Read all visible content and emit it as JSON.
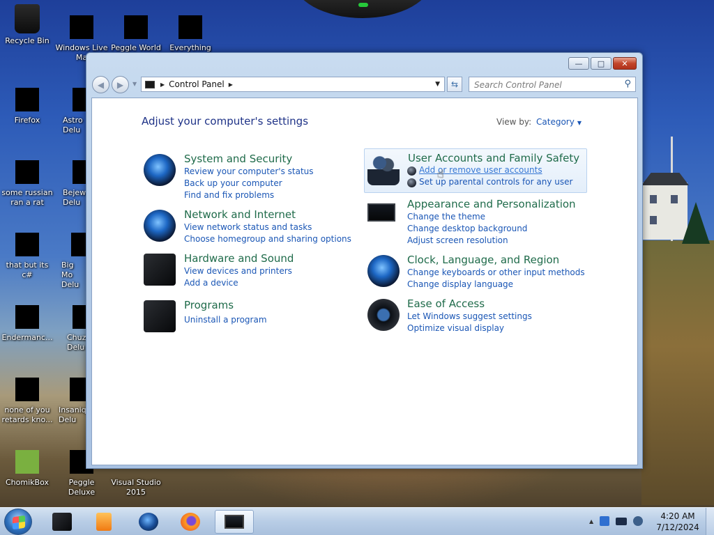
{
  "desktop": {
    "icons": [
      {
        "label": "Recycle Bin",
        "icon": "recycle-bin-icon"
      },
      {
        "label": "Windows Live Ma",
        "icon": "windows-live-icon"
      },
      {
        "label": "Peggle World",
        "icon": "peggle-world-icon"
      },
      {
        "label": "Everything",
        "icon": "everything-icon"
      },
      {
        "label": "Firefox",
        "icon": "firefox-icon"
      },
      {
        "label": "Astro Delu",
        "icon": "astro-deluxe-icon"
      },
      {
        "label": "some russian ran a rat",
        "icon": "app-icon"
      },
      {
        "label": "Bejew Delu",
        "icon": "bejeweled-icon"
      },
      {
        "label": "that but its c#",
        "icon": "app-icon"
      },
      {
        "label": "Big Mo Delu",
        "icon": "big-money-icon"
      },
      {
        "label": "Endermanc...",
        "icon": "app-icon"
      },
      {
        "label": "Chuz Delu",
        "icon": "chuzzle-icon"
      },
      {
        "label": "none of you retards kno...",
        "icon": "app-icon"
      },
      {
        "label": "Insaniq Delu",
        "icon": "insaniquarium-icon"
      },
      {
        "label": "ChomikBox",
        "icon": "chomikbox-icon"
      },
      {
        "label": "Peggle Deluxe",
        "icon": "peggle-deluxe-icon"
      },
      {
        "label": "Visual Studio 2015",
        "icon": "visual-studio-icon"
      }
    ]
  },
  "window": {
    "controls": {
      "minimize": "—",
      "maximize": "□",
      "close": "✕"
    },
    "address": {
      "crumb": "Control Panel"
    },
    "search": {
      "placeholder": "Search Control Panel"
    },
    "page_title": "Adjust your computer's settings",
    "view_by": {
      "label": "View by:",
      "value": "Category"
    },
    "categories": [
      {
        "title": "System and Security",
        "icon": "system-security-icon",
        "links": [
          "Review your computer's status",
          "Back up your computer",
          "Find and fix problems"
        ]
      },
      {
        "title": "Network and Internet",
        "icon": "network-internet-icon",
        "links": [
          "View network status and tasks",
          "Choose homegroup and sharing options"
        ]
      },
      {
        "title": "Hardware and Sound",
        "icon": "hardware-sound-icon",
        "links": [
          "View devices and printers",
          "Add a device"
        ]
      },
      {
        "title": "Programs",
        "icon": "programs-icon",
        "links": [
          "Uninstall a program"
        ]
      },
      {
        "title": "User Accounts and Family Safety",
        "icon": "user-accounts-icon",
        "links": [
          "Add or remove user accounts",
          "Set up parental controls for any user"
        ]
      },
      {
        "title": "Appearance and Personalization",
        "icon": "appearance-icon",
        "links": [
          "Change the theme",
          "Change desktop background",
          "Adjust screen resolution"
        ]
      },
      {
        "title": "Clock, Language, and Region",
        "icon": "clock-language-icon",
        "links": [
          "Change keyboards or other input methods",
          "Change display language"
        ]
      },
      {
        "title": "Ease of Access",
        "icon": "ease-of-access-icon",
        "links": [
          "Let Windows suggest settings",
          "Optimize visual display"
        ]
      }
    ]
  },
  "taskbar": {
    "pinned": [
      "file-explorer-icon",
      "media-player-icon",
      "globe-icon",
      "firefox-icon",
      "control-panel-icon"
    ],
    "clock": {
      "time": "4:20 AM",
      "date": "7/12/2024"
    }
  },
  "colors": {
    "link": "#1a56b5",
    "category_title": "#1f6b4a",
    "page_title": "#1e3287"
  }
}
